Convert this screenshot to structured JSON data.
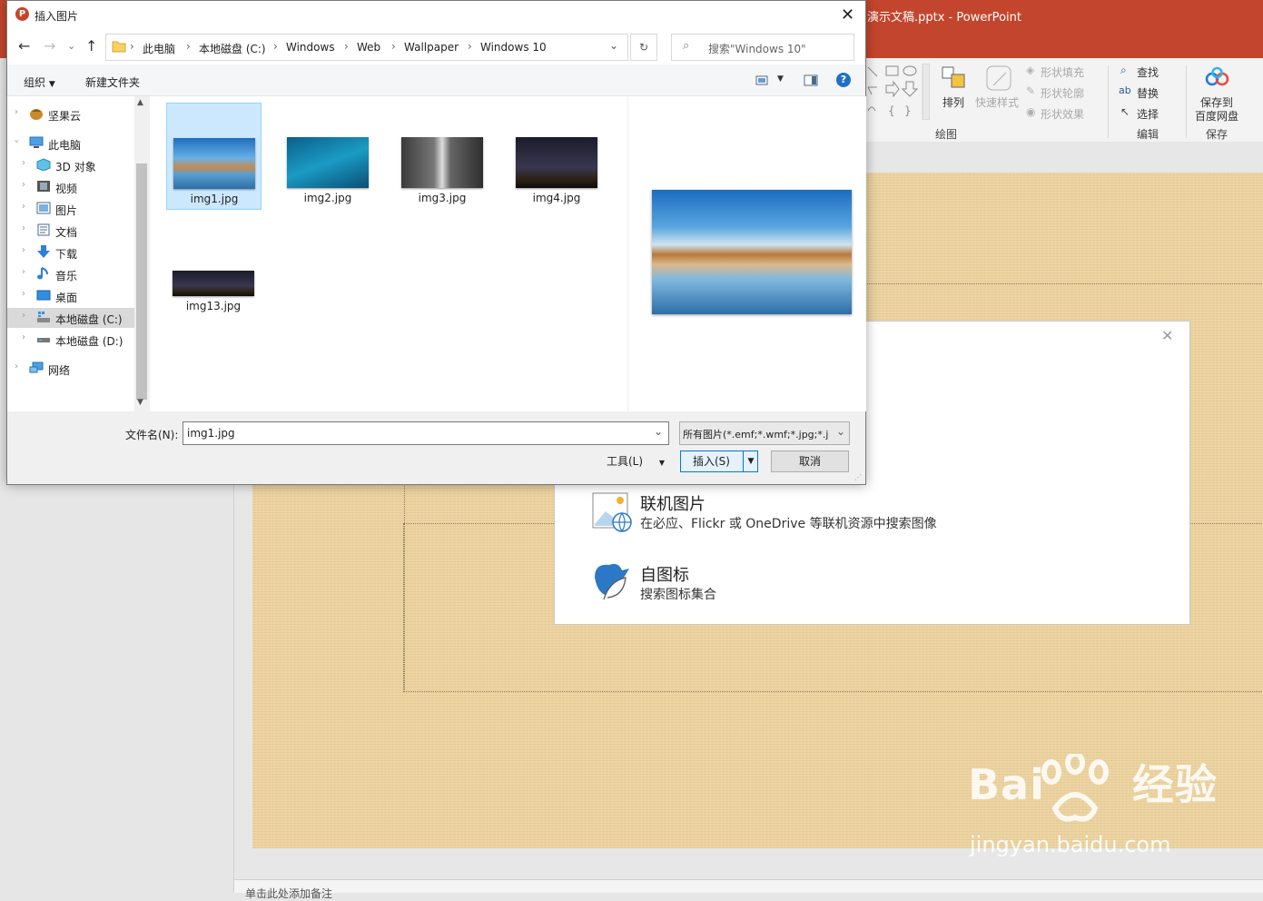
{
  "powerpoint": {
    "title": "演示文稿.pptx  -  PowerPoint",
    "ribbon": {
      "shape_fill": "形状填充",
      "shape_outline": "形状轮廓",
      "shape_effect": "形状效果",
      "arrange": "排列",
      "quick_styles": "快速样式",
      "find": "查找",
      "replace": "替换",
      "select": "选择",
      "save_to": "保存到",
      "baidu_netdisk": "百度网盘",
      "groups": {
        "drawing": "绘图",
        "editing": "编辑",
        "save": "保存"
      }
    },
    "notes_placeholder": "单击此处添加备注",
    "insert_panel": {
      "online_title": "联机图片",
      "online_sub": "在必应、Flickr 或 OneDrive 等联机资源中搜索图像",
      "icons_title": "自图标",
      "icons_sub": "搜索图标集合"
    },
    "watermark": {
      "brand": "Bai",
      "brand2": "经验",
      "url": "jingyan.baidu.com"
    }
  },
  "dialog": {
    "title": "插入图片",
    "breadcrumbs": [
      "此电脑",
      "本地磁盘 (C:)",
      "Windows",
      "Web",
      "Wallpaper",
      "Windows 10"
    ],
    "search_placeholder": "搜索\"Windows 10\"",
    "toolbar": {
      "organize": "组织",
      "new_folder": "新建文件夹"
    },
    "tree": [
      {
        "label": "坚果云",
        "icon": "nut-cloud-icon"
      },
      {
        "label": "此电脑",
        "icon": "computer-icon"
      },
      {
        "label": "3D 对象",
        "icon": "3d-objects-icon"
      },
      {
        "label": "视频",
        "icon": "video-icon"
      },
      {
        "label": "图片",
        "icon": "pictures-icon"
      },
      {
        "label": "文档",
        "icon": "documents-icon"
      },
      {
        "label": "下载",
        "icon": "download-icon"
      },
      {
        "label": "音乐",
        "icon": "music-icon"
      },
      {
        "label": "桌面",
        "icon": "desktop-icon"
      },
      {
        "label": "本地磁盘 (C:)",
        "icon": "drive-c-icon"
      },
      {
        "label": "本地磁盘 (D:)",
        "icon": "drive-d-icon"
      },
      {
        "label": "网络",
        "icon": "network-icon"
      }
    ],
    "files": [
      {
        "name": "img1.jpg",
        "selected": true
      },
      {
        "name": "img2.jpg"
      },
      {
        "name": "img3.jpg"
      },
      {
        "name": "img4.jpg"
      },
      {
        "name": "img13.jpg"
      }
    ],
    "filename_label": "文件名(N):",
    "filename_value": "img1.jpg",
    "filetype_value": "所有图片(*.emf;*.wmf;*.jpg;*.j",
    "tools_label": "工具(L)",
    "insert_label": "插入(S)",
    "cancel_label": "取消"
  }
}
